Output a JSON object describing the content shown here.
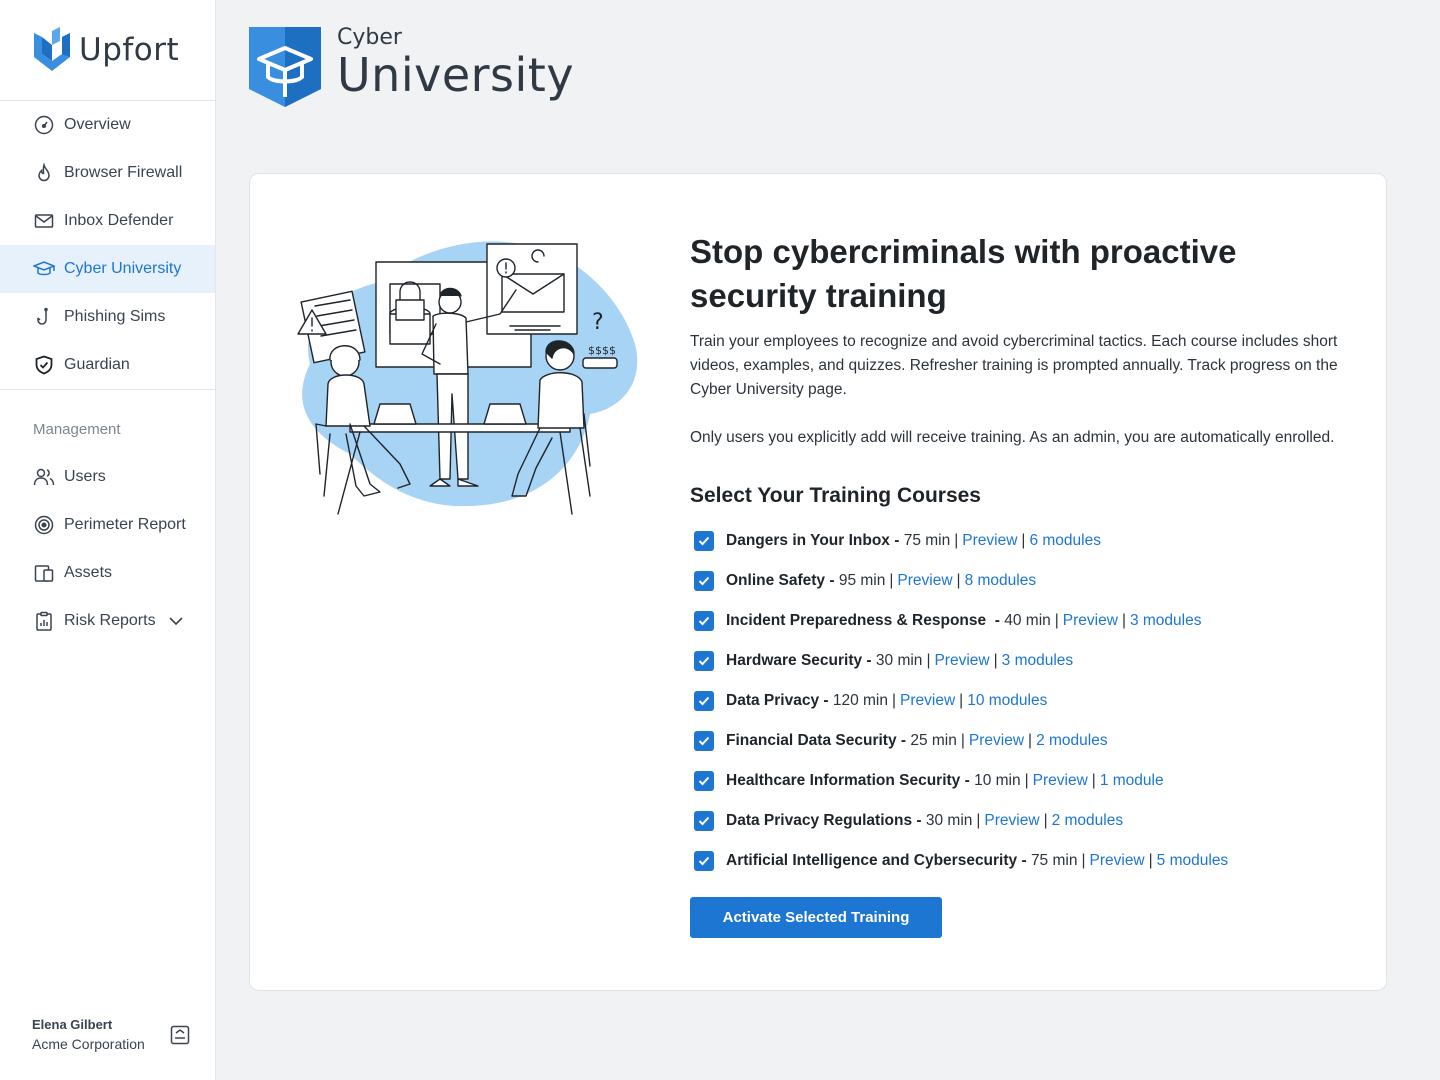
{
  "brand": {
    "name": "Upfort"
  },
  "sidebar": {
    "items": [
      {
        "label": "Overview",
        "icon": "gauge-icon",
        "active": false
      },
      {
        "label": "Browser Firewall",
        "icon": "flame-icon",
        "active": false
      },
      {
        "label": "Inbox Defender",
        "icon": "mail-icon",
        "active": false
      },
      {
        "label": "Cyber University",
        "icon": "graduation-cap-icon",
        "active": true
      },
      {
        "label": "Phishing Sims",
        "icon": "fishhook-icon",
        "active": false
      },
      {
        "label": "Guardian",
        "icon": "shield-check-icon",
        "active": false
      }
    ],
    "management_label": "Management",
    "management_items": [
      {
        "label": "Users",
        "icon": "users-icon"
      },
      {
        "label": "Perimeter Report",
        "icon": "target-icon"
      },
      {
        "label": "Assets",
        "icon": "devices-icon"
      },
      {
        "label": "Risk Reports",
        "icon": "clipboard-icon"
      }
    ],
    "user": {
      "name": "Elena Gilbert",
      "org": "Acme Corporation"
    }
  },
  "header": {
    "small": "Cyber",
    "big": "University"
  },
  "main": {
    "headline": "Stop cybercriminals with proactive security training",
    "paragraph1": "Train your employees to recognize and avoid cybercriminal tactics. Each course includes short videos, examples, and quizzes. Refresher training is prompted annually. Track progress on the Cyber University page.",
    "paragraph2": "Only users you explicitly add will receive training. As an admin, you are automatically enrolled.",
    "courses_title": "Select Your Training Courses",
    "courses": [
      {
        "name": "Dangers in Your Inbox -",
        "duration": "75 min",
        "preview": "Preview",
        "modules": "6 modules",
        "checked": true
      },
      {
        "name": "Online Safety -",
        "duration": "95 min",
        "preview": "Preview",
        "modules": "8 modules",
        "checked": true
      },
      {
        "name": "Incident Preparedness & Response  -",
        "duration": "40 min",
        "preview": "Preview",
        "modules": "3 modules",
        "checked": true
      },
      {
        "name": "Hardware Security -",
        "duration": "30 min",
        "preview": "Preview",
        "modules": "3 modules",
        "checked": true
      },
      {
        "name": "Data Privacy -",
        "duration": "120 min",
        "preview": "Preview",
        "modules": "10 modules",
        "checked": true
      },
      {
        "name": "Financial Data Security -",
        "duration": "25 min",
        "preview": "Preview",
        "modules": "2 modules",
        "checked": true
      },
      {
        "name": "Healthcare Information Security -",
        "duration": "10 min",
        "preview": "Preview",
        "modules": "1 module",
        "checked": true
      },
      {
        "name": "Data Privacy Regulations -",
        "duration": "30 min",
        "preview": "Preview",
        "modules": "2 modules",
        "checked": true
      },
      {
        "name": "Artificial Intelligence and Cybersecurity -",
        "duration": "75 min",
        "preview": "Preview",
        "modules": "5 modules",
        "checked": true
      }
    ],
    "separator": "|",
    "activate_label": "Activate Selected Training"
  },
  "colors": {
    "accent": "#1d76d2",
    "active_bg": "#e7f1fb",
    "illustration_blue": "#a7d3f5"
  }
}
